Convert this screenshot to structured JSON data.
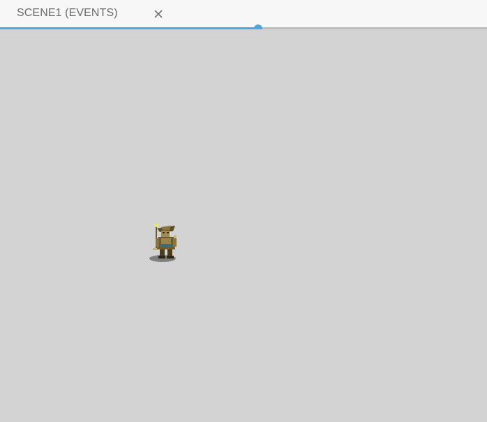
{
  "tab": {
    "title": "SCENE1 (EVENTS)",
    "close_icon": "close-icon"
  },
  "progress": {
    "value_fraction": 0.53
  },
  "scene": {
    "sprite_icon": "character-sprite"
  },
  "colors": {
    "accent": "#4aa9e4",
    "canvas_bg": "#d3d3d3",
    "tabbar_bg": "#f7f7f7"
  }
}
